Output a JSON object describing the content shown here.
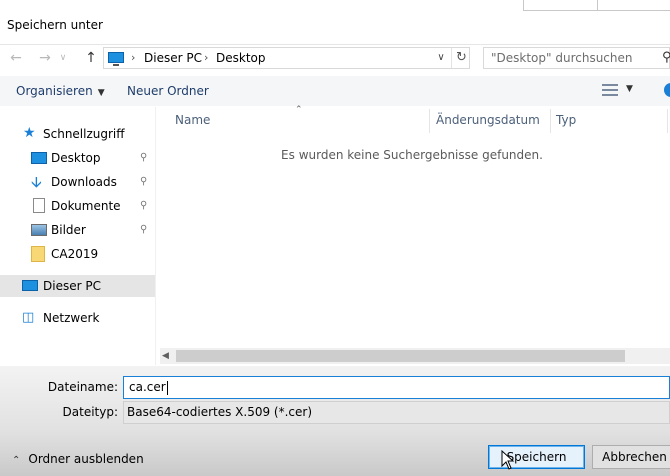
{
  "window": {
    "title": "Speichern unter"
  },
  "nav": {
    "address": {
      "root": "Dieser PC",
      "current": "Desktop"
    },
    "search_placeholder": "\"Desktop\" durchsuchen"
  },
  "toolbar": {
    "organize": "Organisieren",
    "new_folder": "Neuer Ordner"
  },
  "sidebar": {
    "items": [
      {
        "label": "Schnellzugriff",
        "icon": "star-icon"
      },
      {
        "label": "Desktop",
        "icon": "desktop-icon",
        "pinned": true
      },
      {
        "label": "Downloads",
        "icon": "download-icon",
        "pinned": true
      },
      {
        "label": "Dokumente",
        "icon": "document-icon",
        "pinned": true
      },
      {
        "label": "Bilder",
        "icon": "pictures-icon",
        "pinned": true
      },
      {
        "label": "CA2019",
        "icon": "folder-icon"
      },
      {
        "label": "Dieser PC",
        "icon": "computer-icon",
        "selected": true
      },
      {
        "label": "Netzwerk",
        "icon": "network-icon"
      }
    ]
  },
  "filelist": {
    "columns": [
      "Name",
      "Änderungsdatum",
      "Typ"
    ],
    "empty_message": "Es wurden keine Suchergebnisse gefunden."
  },
  "form": {
    "filename_label": "Dateiname:",
    "filename_value": "ca.cer",
    "filetype_label": "Dateityp:",
    "filetype_value": "Base64-codiertes X.509 (*.cer)"
  },
  "footer": {
    "hide_folders": "Ordner ausblenden",
    "save": "Speichern",
    "cancel": "Abbrechen"
  },
  "colors": {
    "accent": "#0078d7",
    "folder": "#f5c64b",
    "selected_bg": "#e5e5e5"
  }
}
